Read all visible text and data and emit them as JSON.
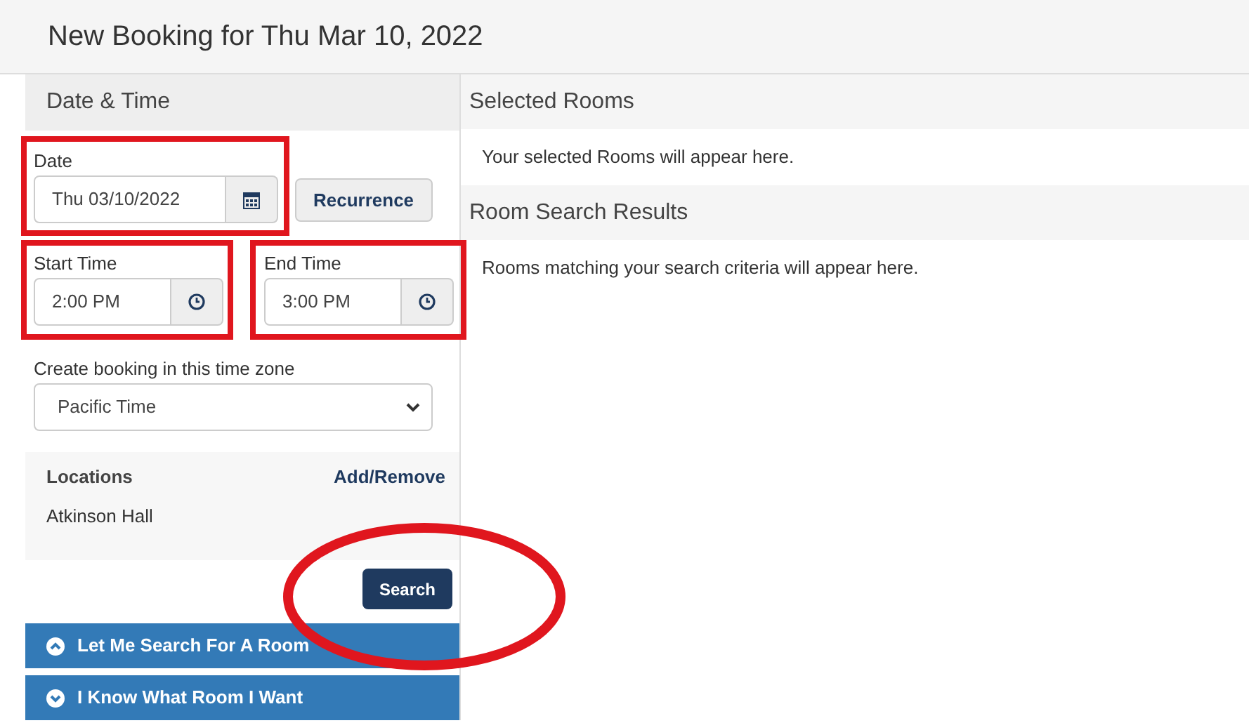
{
  "page": {
    "title": "New Booking for Thu Mar 10, 2022"
  },
  "date_time": {
    "heading": "Date & Time",
    "date": {
      "label": "Date",
      "value": "Thu 03/10/2022"
    },
    "recurrence_button": "Recurrence",
    "start_time": {
      "label": "Start Time",
      "value": "2:00 PM"
    },
    "end_time": {
      "label": "End Time",
      "value": "3:00 PM"
    },
    "time_zone": {
      "label": "Create booking in this time zone",
      "value": "Pacific Time"
    },
    "locations": {
      "heading": "Locations",
      "action": "Add/Remove",
      "items": [
        "Atkinson Hall"
      ]
    },
    "search_button": "Search"
  },
  "panels": [
    {
      "label": "Let Me Search For A Room",
      "expanded": true
    },
    {
      "label": "I Know What Room I Want",
      "expanded": false
    }
  ],
  "selected_rooms": {
    "heading": "Selected Rooms",
    "message": "Your selected Rooms will appear here."
  },
  "room_search_results": {
    "heading": "Room Search Results",
    "message": "Rooms matching your search criteria will appear here."
  }
}
